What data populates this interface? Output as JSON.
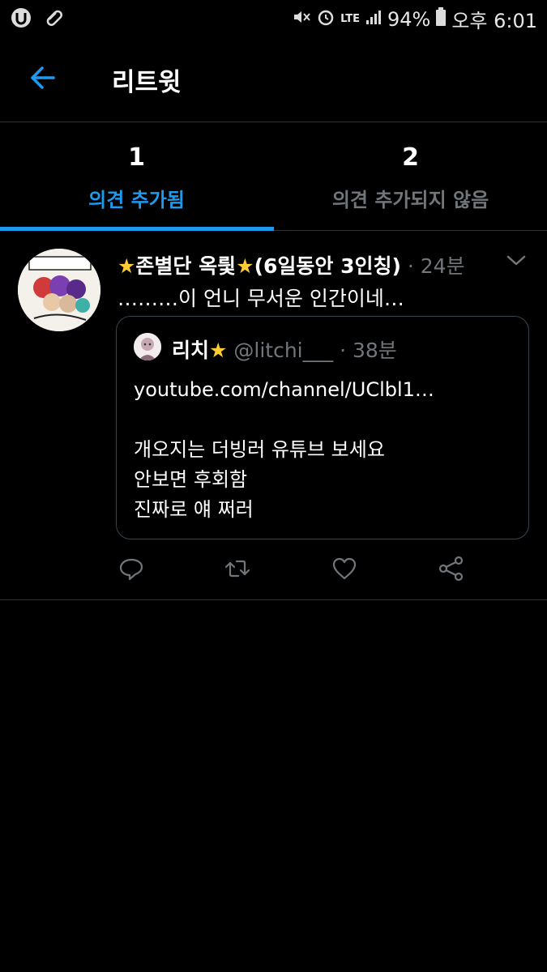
{
  "status_bar": {
    "network": "LTE",
    "battery_percent": "94%",
    "time": "오후 6:01"
  },
  "header": {
    "title": "리트윗"
  },
  "tabs": [
    {
      "count": "1",
      "label": "의견 추가됨",
      "active": true
    },
    {
      "count": "2",
      "label": "의견 추가되지 않음",
      "active": false
    }
  ],
  "tweet": {
    "display_name_prefix": "★",
    "display_name": "존별단 옥릧",
    "display_name_suffix": "★",
    "display_name_extra": "(6일동안 3인칭)",
    "time": "· 24분",
    "text": "………이 언니 무서운 인간이네…",
    "quoted": {
      "display_name": "리치",
      "star": "★",
      "handle": "@litchi___",
      "time": "· 38분",
      "link": "youtube.com/channel/UClbl1…",
      "lines": [
        "개오지는 더빙러 유튜브 보세요",
        "안보면 후회함",
        "진짜로 얘 쩌러"
      ]
    }
  },
  "icons": {
    "back": "arrow-left-icon",
    "caret": "chevron-down-icon",
    "reply": "reply-icon",
    "retweet": "retweet-icon",
    "like": "heart-icon",
    "share": "share-icon"
  },
  "colors": {
    "accent": "#1d9bf0",
    "muted": "#71767b",
    "star": "#ffcc33",
    "background": "#000000"
  }
}
